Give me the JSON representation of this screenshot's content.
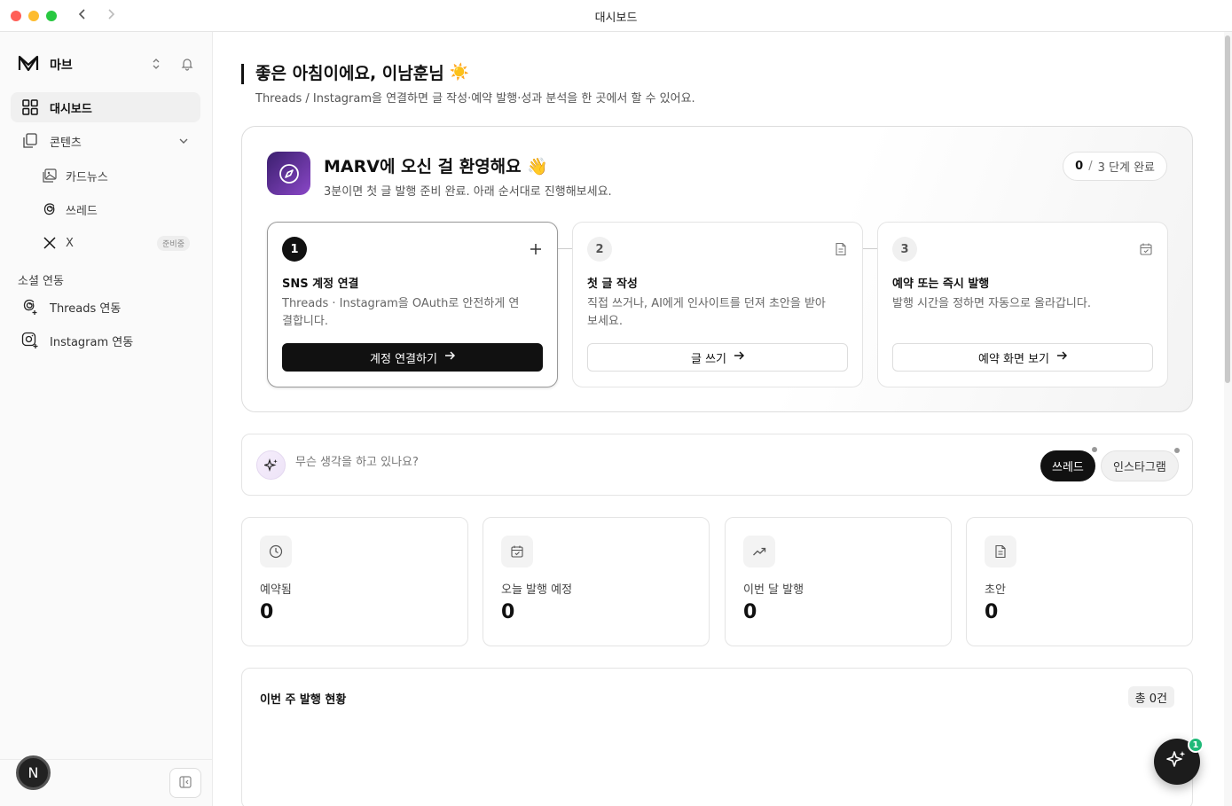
{
  "window": {
    "title": "대시보드"
  },
  "brand": {
    "name": "마브"
  },
  "sidebar": {
    "items": [
      {
        "label": "대시보드"
      },
      {
        "label": "콘텐츠"
      }
    ],
    "sub_items": [
      {
        "label": "카드뉴스"
      },
      {
        "label": "쓰레드"
      },
      {
        "label": "X",
        "badge": "준비중"
      }
    ],
    "section_label": "소셜 연동",
    "social_items": [
      {
        "label": "Threads 연동"
      },
      {
        "label": "Instagram 연동"
      }
    ],
    "avatar_initial": "N"
  },
  "greeting": {
    "title": "좋은 아침이에요, 이남훈님",
    "emoji": "☀️",
    "subtitle": "Threads / Instagram을 연결하면 글 작성·예약 발행·성과 분석을 한 곳에서 할 수 있어요."
  },
  "onboarding": {
    "title": "MARV에 오신 걸 환영해요",
    "emoji": "👋",
    "subtitle": "3분이면 첫 글 발행 준비 완료. 아래 순서대로 진행해보세요.",
    "progress_done": "0",
    "progress_slash": "/",
    "progress_rest": "3 단계 완료",
    "steps": [
      {
        "num": "1",
        "title": "SNS 계정 연결",
        "desc": "Threads · Instagram을 OAuth로 안전하게 연결합니다.",
        "button": "계정 연결하기",
        "icon": "plus-icon"
      },
      {
        "num": "2",
        "title": "첫 글 작성",
        "desc": "직접 쓰거나, AI에게 인사이트를 던져 초안을 받아보세요.",
        "button": "글 쓰기",
        "icon": "document-icon"
      },
      {
        "num": "3",
        "title": "예약 또는 즉시 발행",
        "desc": "발행 시간을 정하면 자동으로 올라갑니다.",
        "button": "예약 화면 보기",
        "icon": "calendar-check-icon"
      }
    ]
  },
  "composer": {
    "placeholder": "무슨 생각을 하고 있나요?",
    "chips": [
      "쓰레드",
      "인스타그램"
    ]
  },
  "stats": [
    {
      "label": "예약됨",
      "value": "0",
      "icon": "clock-icon"
    },
    {
      "label": "오늘 발행 예정",
      "value": "0",
      "icon": "calendar-check-icon"
    },
    {
      "label": "이번 달 발행",
      "value": "0",
      "icon": "trending-up-icon"
    },
    {
      "label": "초안",
      "value": "0",
      "icon": "document-icon"
    }
  ],
  "weekly": {
    "title": "이번 주 발행 현황",
    "total": "총 0건"
  },
  "fab": {
    "badge": "1"
  }
}
